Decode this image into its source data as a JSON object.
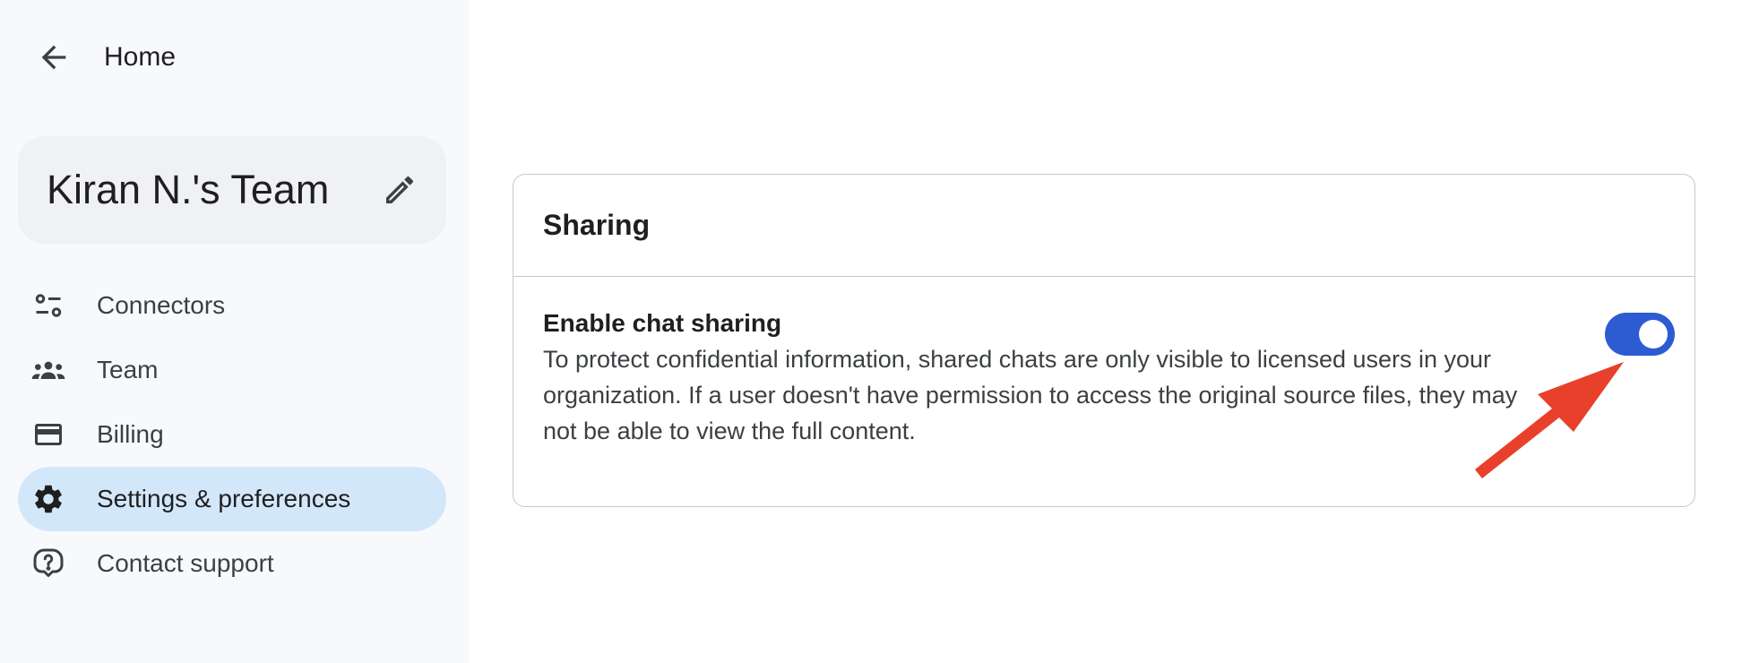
{
  "sidebar": {
    "home_label": "Home",
    "team_name": "Kiran N.'s Team",
    "nav": [
      {
        "label": "Connectors",
        "icon": "connectors-icon"
      },
      {
        "label": "Team",
        "icon": "team-icon"
      },
      {
        "label": "Billing",
        "icon": "credit-card-icon"
      },
      {
        "label": "Settings & preferences",
        "icon": "gear-icon",
        "active": true
      },
      {
        "label": "Contact support",
        "icon": "help-icon"
      }
    ]
  },
  "main": {
    "section_title": "Sharing",
    "setting": {
      "title": "Enable chat sharing",
      "description": "To protect confidential information, shared chats are only visible to licensed users in your organization. If a user doesn't have permission to access the original source files, they may not be able to view the full content.",
      "enabled": true
    }
  },
  "colors": {
    "sidebar_bg": "#f8f9fc",
    "active_nav_bg": "#d3e7fb",
    "toggle_on": "#2d5bd2",
    "annotation_arrow": "#e8402a"
  }
}
